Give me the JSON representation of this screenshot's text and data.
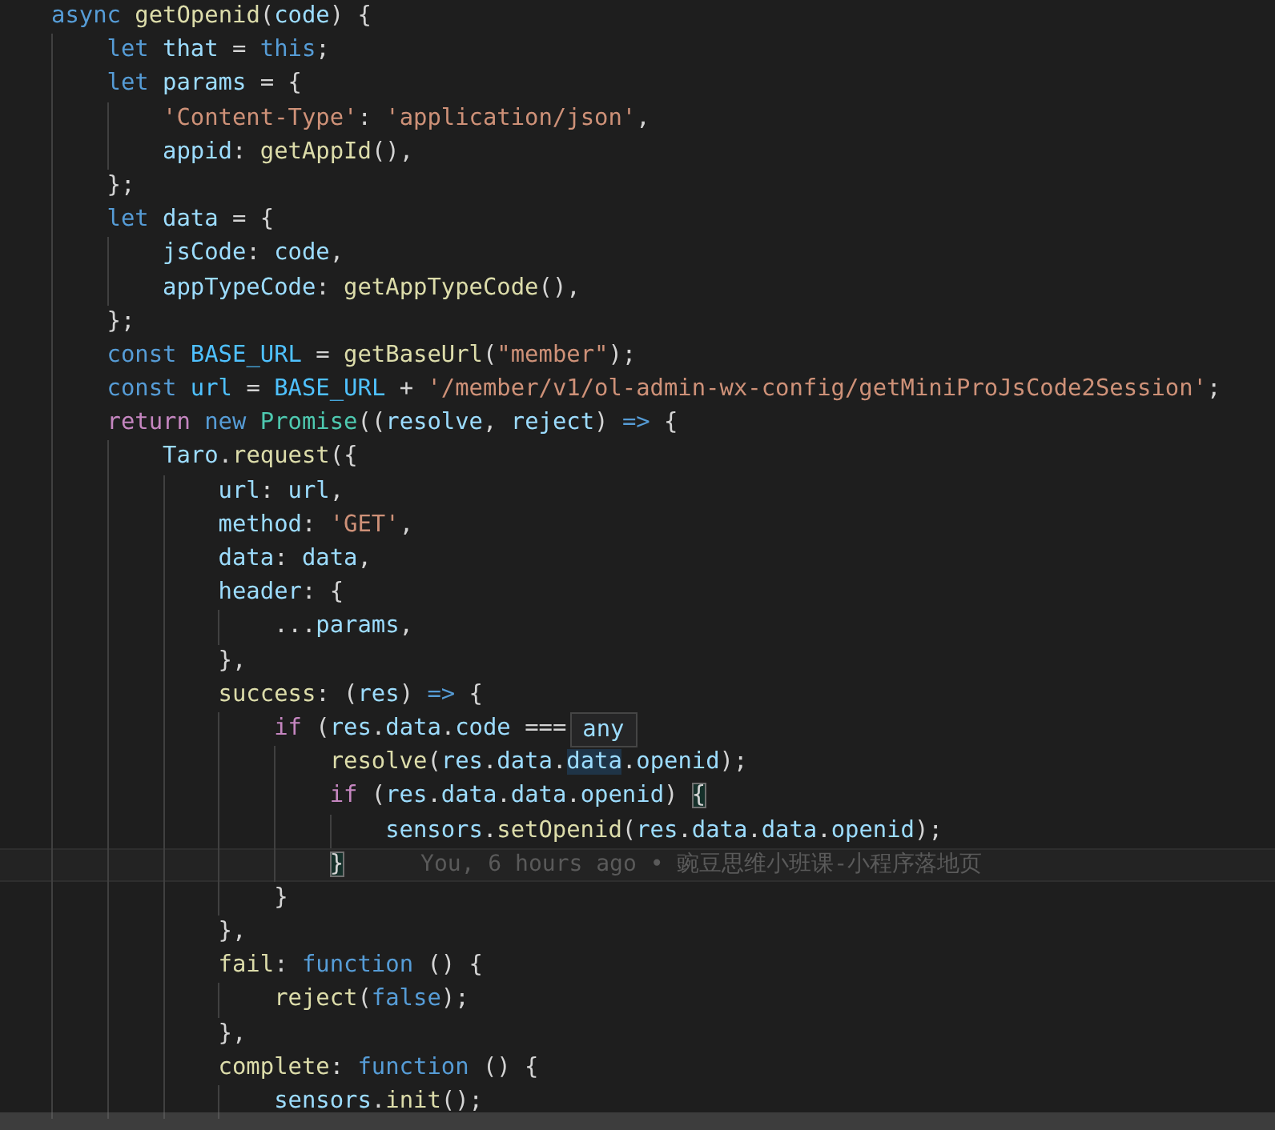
{
  "editor": {
    "lines": [
      {
        "current": false,
        "tokens": [
          {
            "text": "async",
            "kind": "keyword"
          },
          {
            "text": " getOpenid",
            "kind": "function"
          },
          {
            "text": "(",
            "kind": "punct"
          },
          {
            "text": "code",
            "kind": "variable"
          },
          {
            "text": ") {",
            "kind": "punct"
          }
        ],
        "children": [
          {
            "current": false,
            "tokens": [
              {
                "text": "let",
                "kind": "keyword"
              },
              {
                "text": " that",
                "kind": "variable"
              },
              {
                "text": " = ",
                "kind": "punct"
              },
              {
                "text": "this",
                "kind": "keyword"
              },
              {
                "text": ";",
                "kind": "punct"
              }
            ]
          },
          {
            "current": false,
            "tokens": [
              {
                "text": "let",
                "kind": "keyword"
              },
              {
                "text": " params",
                "kind": "variable"
              },
              {
                "text": " = {",
                "kind": "punct"
              }
            ],
            "children": [
              {
                "current": false,
                "tokens": [
                  {
                    "text": "'Content-Type'",
                    "kind": "string"
                  },
                  {
                    "text": ": ",
                    "kind": "punct"
                  },
                  {
                    "text": "'application/json'",
                    "kind": "string"
                  },
                  {
                    "text": ",",
                    "kind": "punct"
                  }
                ]
              },
              {
                "current": false,
                "tokens": [
                  {
                    "text": "appid",
                    "kind": "variable"
                  },
                  {
                    "text": ": ",
                    "kind": "punct"
                  },
                  {
                    "text": "getAppId",
                    "kind": "function"
                  },
                  {
                    "text": "(),",
                    "kind": "punct"
                  }
                ]
              }
            ]
          },
          {
            "current": false,
            "tokens": [
              {
                "text": "};",
                "kind": "punct"
              }
            ]
          },
          {
            "current": false,
            "tokens": [
              {
                "text": "let",
                "kind": "keyword"
              },
              {
                "text": " data",
                "kind": "variable"
              },
              {
                "text": " = {",
                "kind": "punct"
              }
            ],
            "children": [
              {
                "current": false,
                "tokens": [
                  {
                    "text": "jsCode",
                    "kind": "variable"
                  },
                  {
                    "text": ": ",
                    "kind": "punct"
                  },
                  {
                    "text": "code",
                    "kind": "variable"
                  },
                  {
                    "text": ",",
                    "kind": "punct"
                  }
                ]
              },
              {
                "current": false,
                "tokens": [
                  {
                    "text": "appTypeCode",
                    "kind": "variable"
                  },
                  {
                    "text": ": ",
                    "kind": "punct"
                  },
                  {
                    "text": "getAppTypeCode",
                    "kind": "function"
                  },
                  {
                    "text": "(),",
                    "kind": "punct"
                  }
                ]
              }
            ]
          },
          {
            "current": false,
            "tokens": [
              {
                "text": "};",
                "kind": "punct"
              }
            ]
          },
          {
            "current": false,
            "tokens": [
              {
                "text": "const",
                "kind": "keyword"
              },
              {
                "text": " BASE_URL",
                "kind": "constant"
              },
              {
                "text": " = ",
                "kind": "punct"
              },
              {
                "text": "getBaseUrl",
                "kind": "function"
              },
              {
                "text": "(",
                "kind": "punct"
              },
              {
                "text": "\"member\"",
                "kind": "string"
              },
              {
                "text": ");",
                "kind": "punct"
              }
            ]
          },
          {
            "current": false,
            "tokens": [
              {
                "text": "const",
                "kind": "keyword"
              },
              {
                "text": " url",
                "kind": "constant"
              },
              {
                "text": " = ",
                "kind": "punct"
              },
              {
                "text": "BASE_URL",
                "kind": "constant"
              },
              {
                "text": " + ",
                "kind": "punct"
              },
              {
                "text": "'/member/v1/ol-admin-wx-config/getMiniProJsCode2Session'",
                "kind": "string"
              },
              {
                "text": ";",
                "kind": "punct"
              }
            ]
          },
          {
            "current": false,
            "tokens": [
              {
                "text": "return",
                "kind": "control"
              },
              {
                "text": " new",
                "kind": "keyword"
              },
              {
                "text": " Promise",
                "kind": "type"
              },
              {
                "text": "((",
                "kind": "punct"
              },
              {
                "text": "resolve",
                "kind": "variable"
              },
              {
                "text": ", ",
                "kind": "punct"
              },
              {
                "text": "reject",
                "kind": "variable"
              },
              {
                "text": ") ",
                "kind": "punct"
              },
              {
                "text": "=>",
                "kind": "keyword"
              },
              {
                "text": " {",
                "kind": "punct"
              }
            ],
            "children": [
              {
                "current": false,
                "tokens": [
                  {
                    "text": "Taro",
                    "kind": "variable"
                  },
                  {
                    "text": ".",
                    "kind": "punct"
                  },
                  {
                    "text": "request",
                    "kind": "function"
                  },
                  {
                    "text": "({",
                    "kind": "punct"
                  }
                ],
                "children": [
                  {
                    "current": false,
                    "tokens": [
                      {
                        "text": "url",
                        "kind": "variable"
                      },
                      {
                        "text": ": ",
                        "kind": "punct"
                      },
                      {
                        "text": "url",
                        "kind": "variable"
                      },
                      {
                        "text": ",",
                        "kind": "punct"
                      }
                    ]
                  },
                  {
                    "current": false,
                    "tokens": [
                      {
                        "text": "method",
                        "kind": "variable"
                      },
                      {
                        "text": ": ",
                        "kind": "punct"
                      },
                      {
                        "text": "'GET'",
                        "kind": "string"
                      },
                      {
                        "text": ",",
                        "kind": "punct"
                      }
                    ]
                  },
                  {
                    "current": false,
                    "tokens": [
                      {
                        "text": "data",
                        "kind": "variable"
                      },
                      {
                        "text": ": ",
                        "kind": "punct"
                      },
                      {
                        "text": "data",
                        "kind": "variable"
                      },
                      {
                        "text": ",",
                        "kind": "punct"
                      }
                    ]
                  },
                  {
                    "current": false,
                    "tokens": [
                      {
                        "text": "header",
                        "kind": "variable"
                      },
                      {
                        "text": ": {",
                        "kind": "punct"
                      }
                    ],
                    "children": [
                      {
                        "current": false,
                        "tokens": [
                          {
                            "text": "...",
                            "kind": "punct"
                          },
                          {
                            "text": "params",
                            "kind": "variable"
                          },
                          {
                            "text": ",",
                            "kind": "punct"
                          }
                        ]
                      }
                    ]
                  },
                  {
                    "current": false,
                    "tokens": [
                      {
                        "text": "},",
                        "kind": "punct"
                      }
                    ]
                  },
                  {
                    "current": false,
                    "tokens": [
                      {
                        "text": "success",
                        "kind": "function"
                      },
                      {
                        "text": ": (",
                        "kind": "punct"
                      },
                      {
                        "text": "res",
                        "kind": "variable"
                      },
                      {
                        "text": ") ",
                        "kind": "punct"
                      },
                      {
                        "text": "=>",
                        "kind": "keyword"
                      },
                      {
                        "text": " {",
                        "kind": "punct"
                      }
                    ],
                    "children": [
                      {
                        "current": false,
                        "tokens": [
                          {
                            "text": "if",
                            "kind": "control"
                          },
                          {
                            "text": " (",
                            "kind": "punct"
                          },
                          {
                            "text": "res",
                            "kind": "variable"
                          },
                          {
                            "text": ".",
                            "kind": "punct"
                          },
                          {
                            "text": "data",
                            "kind": "variable"
                          },
                          {
                            "text": ".",
                            "kind": "punct"
                          },
                          {
                            "text": "code",
                            "kind": "variable"
                          },
                          {
                            "text": " ===",
                            "kind": "punct"
                          }
                        ],
                        "tooltip": "any",
                        "children": [
                          {
                            "current": false,
                            "tokens": [
                              {
                                "text": "resolve",
                                "kind": "function"
                              },
                              {
                                "text": "(",
                                "kind": "punct"
                              },
                              {
                                "text": "res",
                                "kind": "variable"
                              },
                              {
                                "text": ".",
                                "kind": "punct"
                              },
                              {
                                "text": "data",
                                "kind": "variable"
                              },
                              {
                                "text": ".",
                                "kind": "punct"
                              },
                              {
                                "text": "data",
                                "kind": "occurrence"
                              },
                              {
                                "text": ".",
                                "kind": "punct"
                              },
                              {
                                "text": "openid",
                                "kind": "variable"
                              },
                              {
                                "text": ");",
                                "kind": "punct"
                              }
                            ]
                          },
                          {
                            "current": false,
                            "tokens": [
                              {
                                "text": "if",
                                "kind": "control"
                              },
                              {
                                "text": " (",
                                "kind": "punct"
                              },
                              {
                                "text": "res",
                                "kind": "variable"
                              },
                              {
                                "text": ".",
                                "kind": "punct"
                              },
                              {
                                "text": "data",
                                "kind": "variable"
                              },
                              {
                                "text": ".",
                                "kind": "punct"
                              },
                              {
                                "text": "data",
                                "kind": "variable"
                              },
                              {
                                "text": ".",
                                "kind": "punct"
                              },
                              {
                                "text": "openid",
                                "kind": "variable"
                              },
                              {
                                "text": ") ",
                                "kind": "punct"
                              },
                              {
                                "text": "{",
                                "kind": "bracket"
                              }
                            ],
                            "children": [
                              {
                                "current": false,
                                "tokens": [
                                  {
                                    "text": "sensors",
                                    "kind": "variable"
                                  },
                                  {
                                    "text": ".",
                                    "kind": "punct"
                                  },
                                  {
                                    "text": "setOpenid",
                                    "kind": "function"
                                  },
                                  {
                                    "text": "(",
                                    "kind": "punct"
                                  },
                                  {
                                    "text": "res",
                                    "kind": "variable"
                                  },
                                  {
                                    "text": ".",
                                    "kind": "punct"
                                  },
                                  {
                                    "text": "data",
                                    "kind": "variable"
                                  },
                                  {
                                    "text": ".",
                                    "kind": "punct"
                                  },
                                  {
                                    "text": "data",
                                    "kind": "variable"
                                  },
                                  {
                                    "text": ".",
                                    "kind": "punct"
                                  },
                                  {
                                    "text": "openid",
                                    "kind": "variable"
                                  },
                                  {
                                    "text": ");",
                                    "kind": "punct"
                                  }
                                ]
                              }
                            ]
                          },
                          {
                            "current": true,
                            "tokens": [
                              {
                                "text": "}",
                                "kind": "bracket"
                              }
                            ],
                            "annotation": "You, 6 hours ago • 豌豆思维小班课-小程序落地页"
                          }
                        ]
                      },
                      {
                        "current": false,
                        "tokens": [
                          {
                            "text": "}",
                            "kind": "punct"
                          }
                        ]
                      }
                    ]
                  },
                  {
                    "current": false,
                    "tokens": [
                      {
                        "text": "},",
                        "kind": "punct"
                      }
                    ]
                  },
                  {
                    "current": false,
                    "tokens": [
                      {
                        "text": "fail",
                        "kind": "function"
                      },
                      {
                        "text": ": ",
                        "kind": "punct"
                      },
                      {
                        "text": "function",
                        "kind": "keyword"
                      },
                      {
                        "text": " () {",
                        "kind": "punct"
                      }
                    ],
                    "children": [
                      {
                        "current": false,
                        "tokens": [
                          {
                            "text": "reject",
                            "kind": "function"
                          },
                          {
                            "text": "(",
                            "kind": "punct"
                          },
                          {
                            "text": "false",
                            "kind": "keyword"
                          },
                          {
                            "text": ");",
                            "kind": "punct"
                          }
                        ]
                      }
                    ]
                  },
                  {
                    "current": false,
                    "tokens": [
                      {
                        "text": "},",
                        "kind": "punct"
                      }
                    ]
                  },
                  {
                    "current": false,
                    "tokens": [
                      {
                        "text": "complete",
                        "kind": "function"
                      },
                      {
                        "text": ": ",
                        "kind": "punct"
                      },
                      {
                        "text": "function",
                        "kind": "keyword"
                      },
                      {
                        "text": " () {",
                        "kind": "punct"
                      }
                    ],
                    "children": [
                      {
                        "current": false,
                        "tokens": [
                          {
                            "text": "sensors",
                            "kind": "variable"
                          },
                          {
                            "text": ".",
                            "kind": "punct"
                          },
                          {
                            "text": "init",
                            "kind": "function"
                          },
                          {
                            "text": "();",
                            "kind": "punct"
                          }
                        ]
                      }
                    ]
                  }
                ]
              }
            ]
          }
        ]
      }
    ]
  }
}
